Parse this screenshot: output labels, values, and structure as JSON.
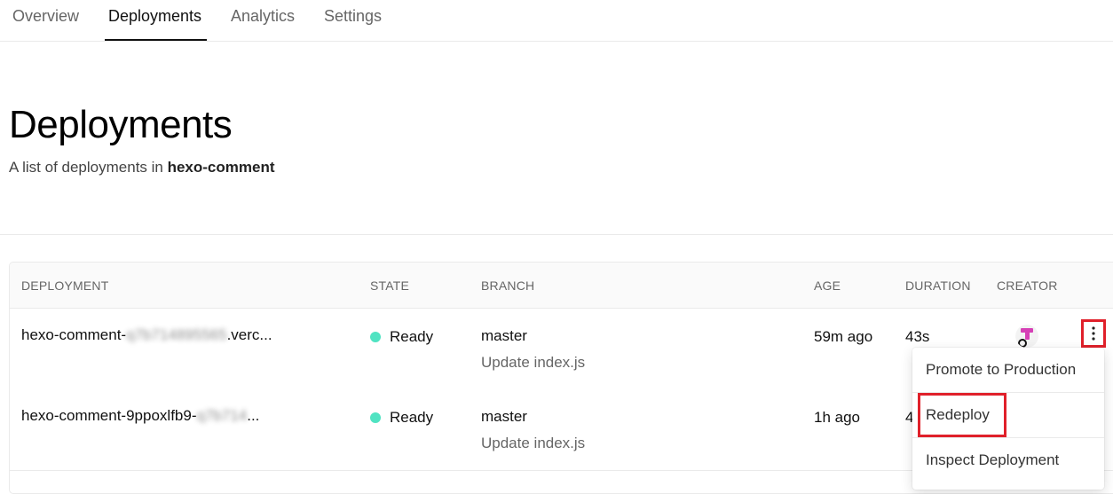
{
  "tabs": [
    {
      "label": "Overview",
      "active": false
    },
    {
      "label": "Deployments",
      "active": true
    },
    {
      "label": "Analytics",
      "active": false
    },
    {
      "label": "Settings",
      "active": false
    }
  ],
  "header": {
    "title": "Deployments",
    "subtitle_prefix": "A list of deployments in ",
    "project": "hexo-comment"
  },
  "table": {
    "columns": [
      "DEPLOYMENT",
      "STATE",
      "BRANCH",
      "AGE",
      "DURATION",
      "CREATOR"
    ],
    "rows": [
      {
        "name_prefix": "hexo-comment-",
        "name_redacted": "q7b714895565",
        "name_suffix": ".verc...",
        "state": "Ready",
        "branch": "master",
        "commit": "Update index.js",
        "age": "59m ago",
        "duration": "43s"
      },
      {
        "name_prefix": "hexo-comment-9ppoxlfb9-",
        "name_redacted": "q7b714",
        "name_suffix": "...",
        "state": "Ready",
        "branch": "master",
        "commit": "Update index.js",
        "age": "1h ago",
        "duration": "4"
      }
    ]
  },
  "menu": {
    "items": [
      "Promote to Production",
      "Redeploy",
      "Inspect Deployment"
    ]
  },
  "colors": {
    "ready": "#50e3c2",
    "highlight": "#e0202a",
    "avatar": "#d63fb6"
  }
}
